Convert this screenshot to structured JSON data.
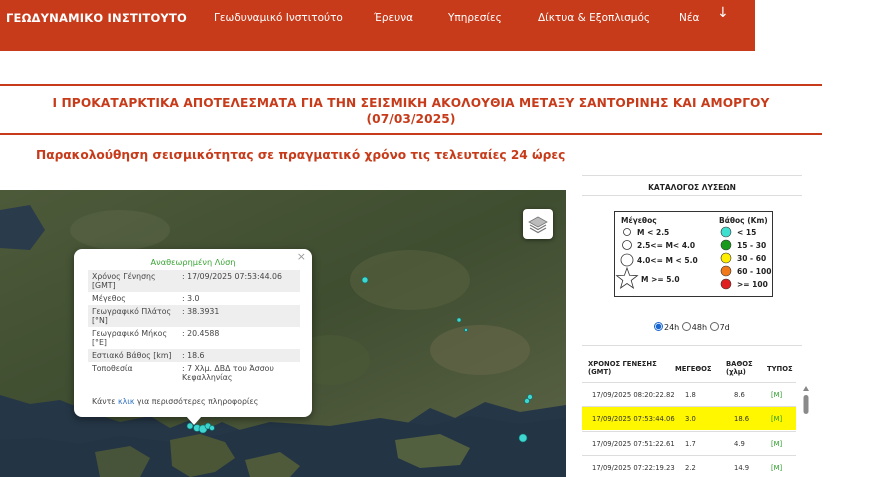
{
  "nav": {
    "brand": "ΓΕΩΔΥΝΑΜΙΚΟ ΙΝΣΤΙΤΟΥΤΟ",
    "items": [
      {
        "label": "Γεωδυναμικό Ινστιτούτο"
      },
      {
        "label": "Έρευνα"
      },
      {
        "label": "Υπηρεσίες"
      },
      {
        "label": "Δίκτυα & Εξοπλισμός"
      },
      {
        "label": "Νέα"
      }
    ],
    "arrow": "↓"
  },
  "headline": {
    "line1": "Ι ΠΡΟΚΑΤΑΡΚΤΙΚΑ ΑΠΟΤΕΛΕΣΜΑΤΑ ΓΙΑ ΤΗΝ ΣΕΙΣΜΙΚΗ ΑΚΟΛΟΥΘΙΑ ΜΕΤΑΞΥ ΣΑΝΤΟΡΙΝΗΣ ΚΑΙ ΑΜΟΡΓΟΥ",
    "line2": "(07/03/2025)"
  },
  "subheading": "Παρακολούθηση σεισμικότητας σε πραγματικό χρόνο τις τελευταίες 24 ώρες",
  "map": {
    "popup": {
      "title": "Αναθεωρημένη Λύση",
      "close": "×",
      "rows": [
        {
          "label": "Χρόνος Γένησης [GMT]",
          "value": ": 17/09/2025 07:53:44.06"
        },
        {
          "label": "Μέγεθος",
          "value": ": 3.0"
        },
        {
          "label": "Γεωγραφικό Πλάτος [°N]",
          "value": ": 38.3931"
        },
        {
          "label": "Γεωγραφικό Μήκος [°E]",
          "value": ": 20.4588"
        },
        {
          "label": "Εστιακό Βάθος [km]",
          "value": ": 18.6"
        },
        {
          "label": "Τοποθεσία",
          "value": ": 7 Χλμ. ΔΒΔ του Άσσου Κεφαλληνίας"
        }
      ],
      "footer_pre": "Κάντε ",
      "footer_link": "κλικ",
      "footer_post": " για περισσότερες πληροφορίες"
    },
    "layers_icon": "layers-icon"
  },
  "panel": {
    "title": "ΚΑΤΑΛΟΓΟΣ ΛΥΣΕΩΝ",
    "legend": {
      "magnitude_title": "Μέγεθος",
      "depth_title": "Βάθος (Km)",
      "magnitudes": [
        "M < 2.5",
        "2.5<= M< 4.0",
        "4.0<= M < 5.0",
        "M >= 5.0"
      ],
      "depths": [
        {
          "label": "< 15",
          "color": "#40e0d0"
        },
        {
          "label": "15 - 30",
          "color": "#1a9a1a"
        },
        {
          "label": "30 - 60",
          "color": "#ffee00"
        },
        {
          "label": "60 - 100",
          "color": "#f07a1a"
        },
        {
          "label": ">= 100",
          "color": "#e02020"
        }
      ]
    },
    "periods": [
      {
        "label": "24h",
        "selected": true
      },
      {
        "label": "48h",
        "selected": false
      },
      {
        "label": "7d",
        "selected": false
      }
    ],
    "columns": {
      "time_line1": "ΧΡΟΝΟΣ ΓΕΝΕΣΗΣ",
      "time_line2": "(GMT)",
      "mag": "ΜΕΓΕΘΟΣ",
      "depth_line1": "ΒΑΘΟΣ",
      "depth_line2": "(χλμ)",
      "type": "ΤΥΠΟΣ"
    },
    "rows": [
      {
        "time": "17/09/2025 08:20:22.82",
        "mag": "1.8",
        "depth": "8.6",
        "type": "[M]"
      },
      {
        "time": "17/09/2025 07:53:44.06",
        "mag": "3.0",
        "depth": "18.6",
        "type": "[M]"
      },
      {
        "time": "17/09/2025 07:51:22.61",
        "mag": "1.7",
        "depth": "4.9",
        "type": "[M]"
      },
      {
        "time": "17/09/2025 07:22:19.23",
        "mag": "2.2",
        "depth": "14.9",
        "type": "[M]"
      }
    ]
  }
}
